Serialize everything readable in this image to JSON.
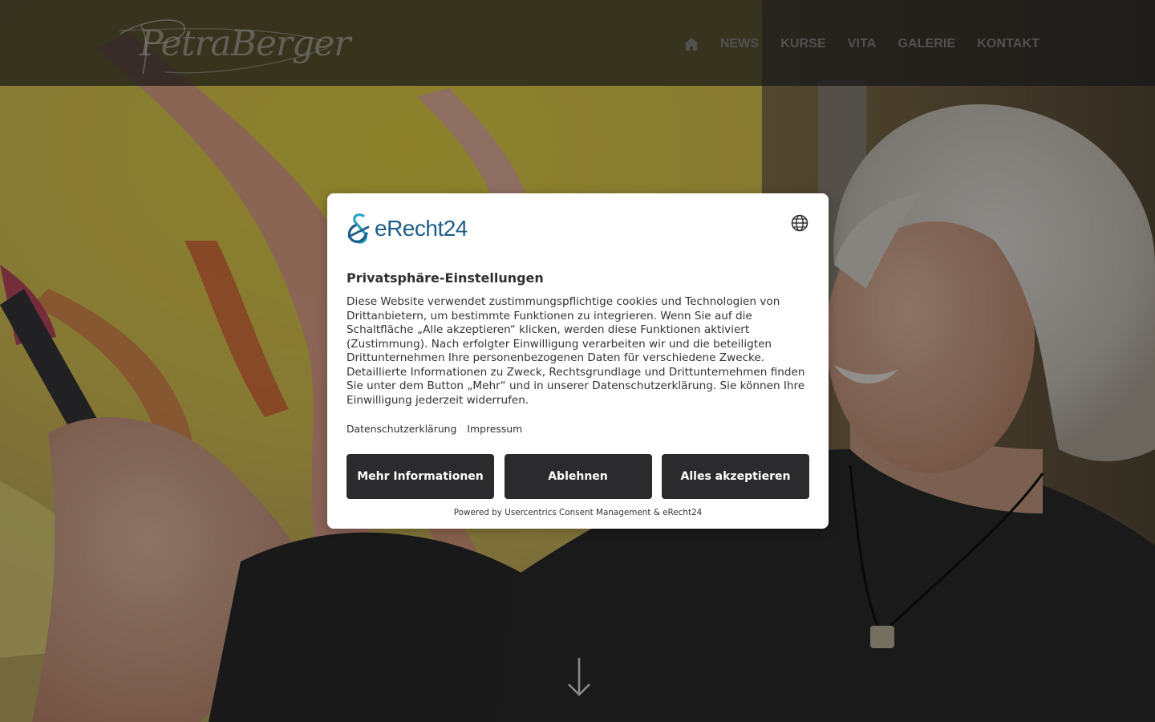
{
  "header": {
    "logo_text": "PetraBerger",
    "nav": {
      "home_icon": "home-icon",
      "items": [
        "NEWS",
        "KURSE",
        "VITA",
        "GALERIE",
        "KONTAKT"
      ]
    }
  },
  "hero": {
    "scroll_icon": "arrow-down-icon"
  },
  "consent": {
    "brand": "eRecht24",
    "language_icon": "globe-icon",
    "title": "Privatsphäre-Einstellungen",
    "text": "Diese Website verwendet zustimmungspflichtige cookies und Technologien von Drittanbietern, um bestimmte Funktionen zu integrieren. Wenn Sie auf die Schaltfläche „Alle akzeptieren“ klicken, werden diese Funktionen aktiviert (Zustimmung). Nach erfolgter Einwilligung verarbeiten wir und die beteiligten Drittunternehmen Ihre personenbezogenen Daten für verschiedene Zwecke. Detaillierte Informationen zu Zweck, Rechtsgrundlage und Drittunternehmen finden Sie unter dem Button „Mehr“ und in unserer Datenschutzerklärung. Sie können Ihre Einwilligung jederzeit widerrufen.",
    "links": {
      "privacy": "Datenschutzerklärung",
      "imprint": "Impressum"
    },
    "buttons": {
      "more": "Mehr Informationen",
      "deny": "Ablehnen",
      "accept_all": "Alles akzeptieren"
    },
    "powered_by": "Powered by Usercentrics Consent Management & eRecht24"
  },
  "colors": {
    "button_bg": "#2b2b2e",
    "brand_blue": "#1d5d8a",
    "brand_teal": "#2aa3c4",
    "nav_text": "#8c8c8c"
  }
}
